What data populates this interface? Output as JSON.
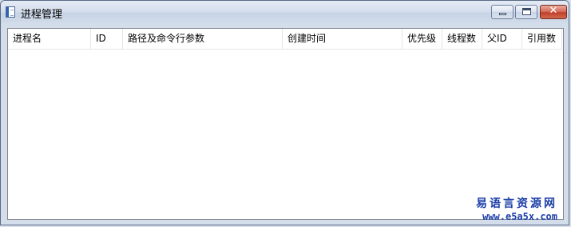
{
  "window": {
    "title": "进程管理",
    "minimize_label": "",
    "maximize_label": "",
    "close_label": "✕"
  },
  "list": {
    "columns": [
      "进程名",
      "ID",
      "路径及命令行参数",
      "创建时间",
      "优先级",
      "线程数",
      "父ID",
      "引用数"
    ],
    "rows": []
  },
  "watermark": {
    "brand": "易语言资源网",
    "url": "www.e5a5x.com"
  }
}
